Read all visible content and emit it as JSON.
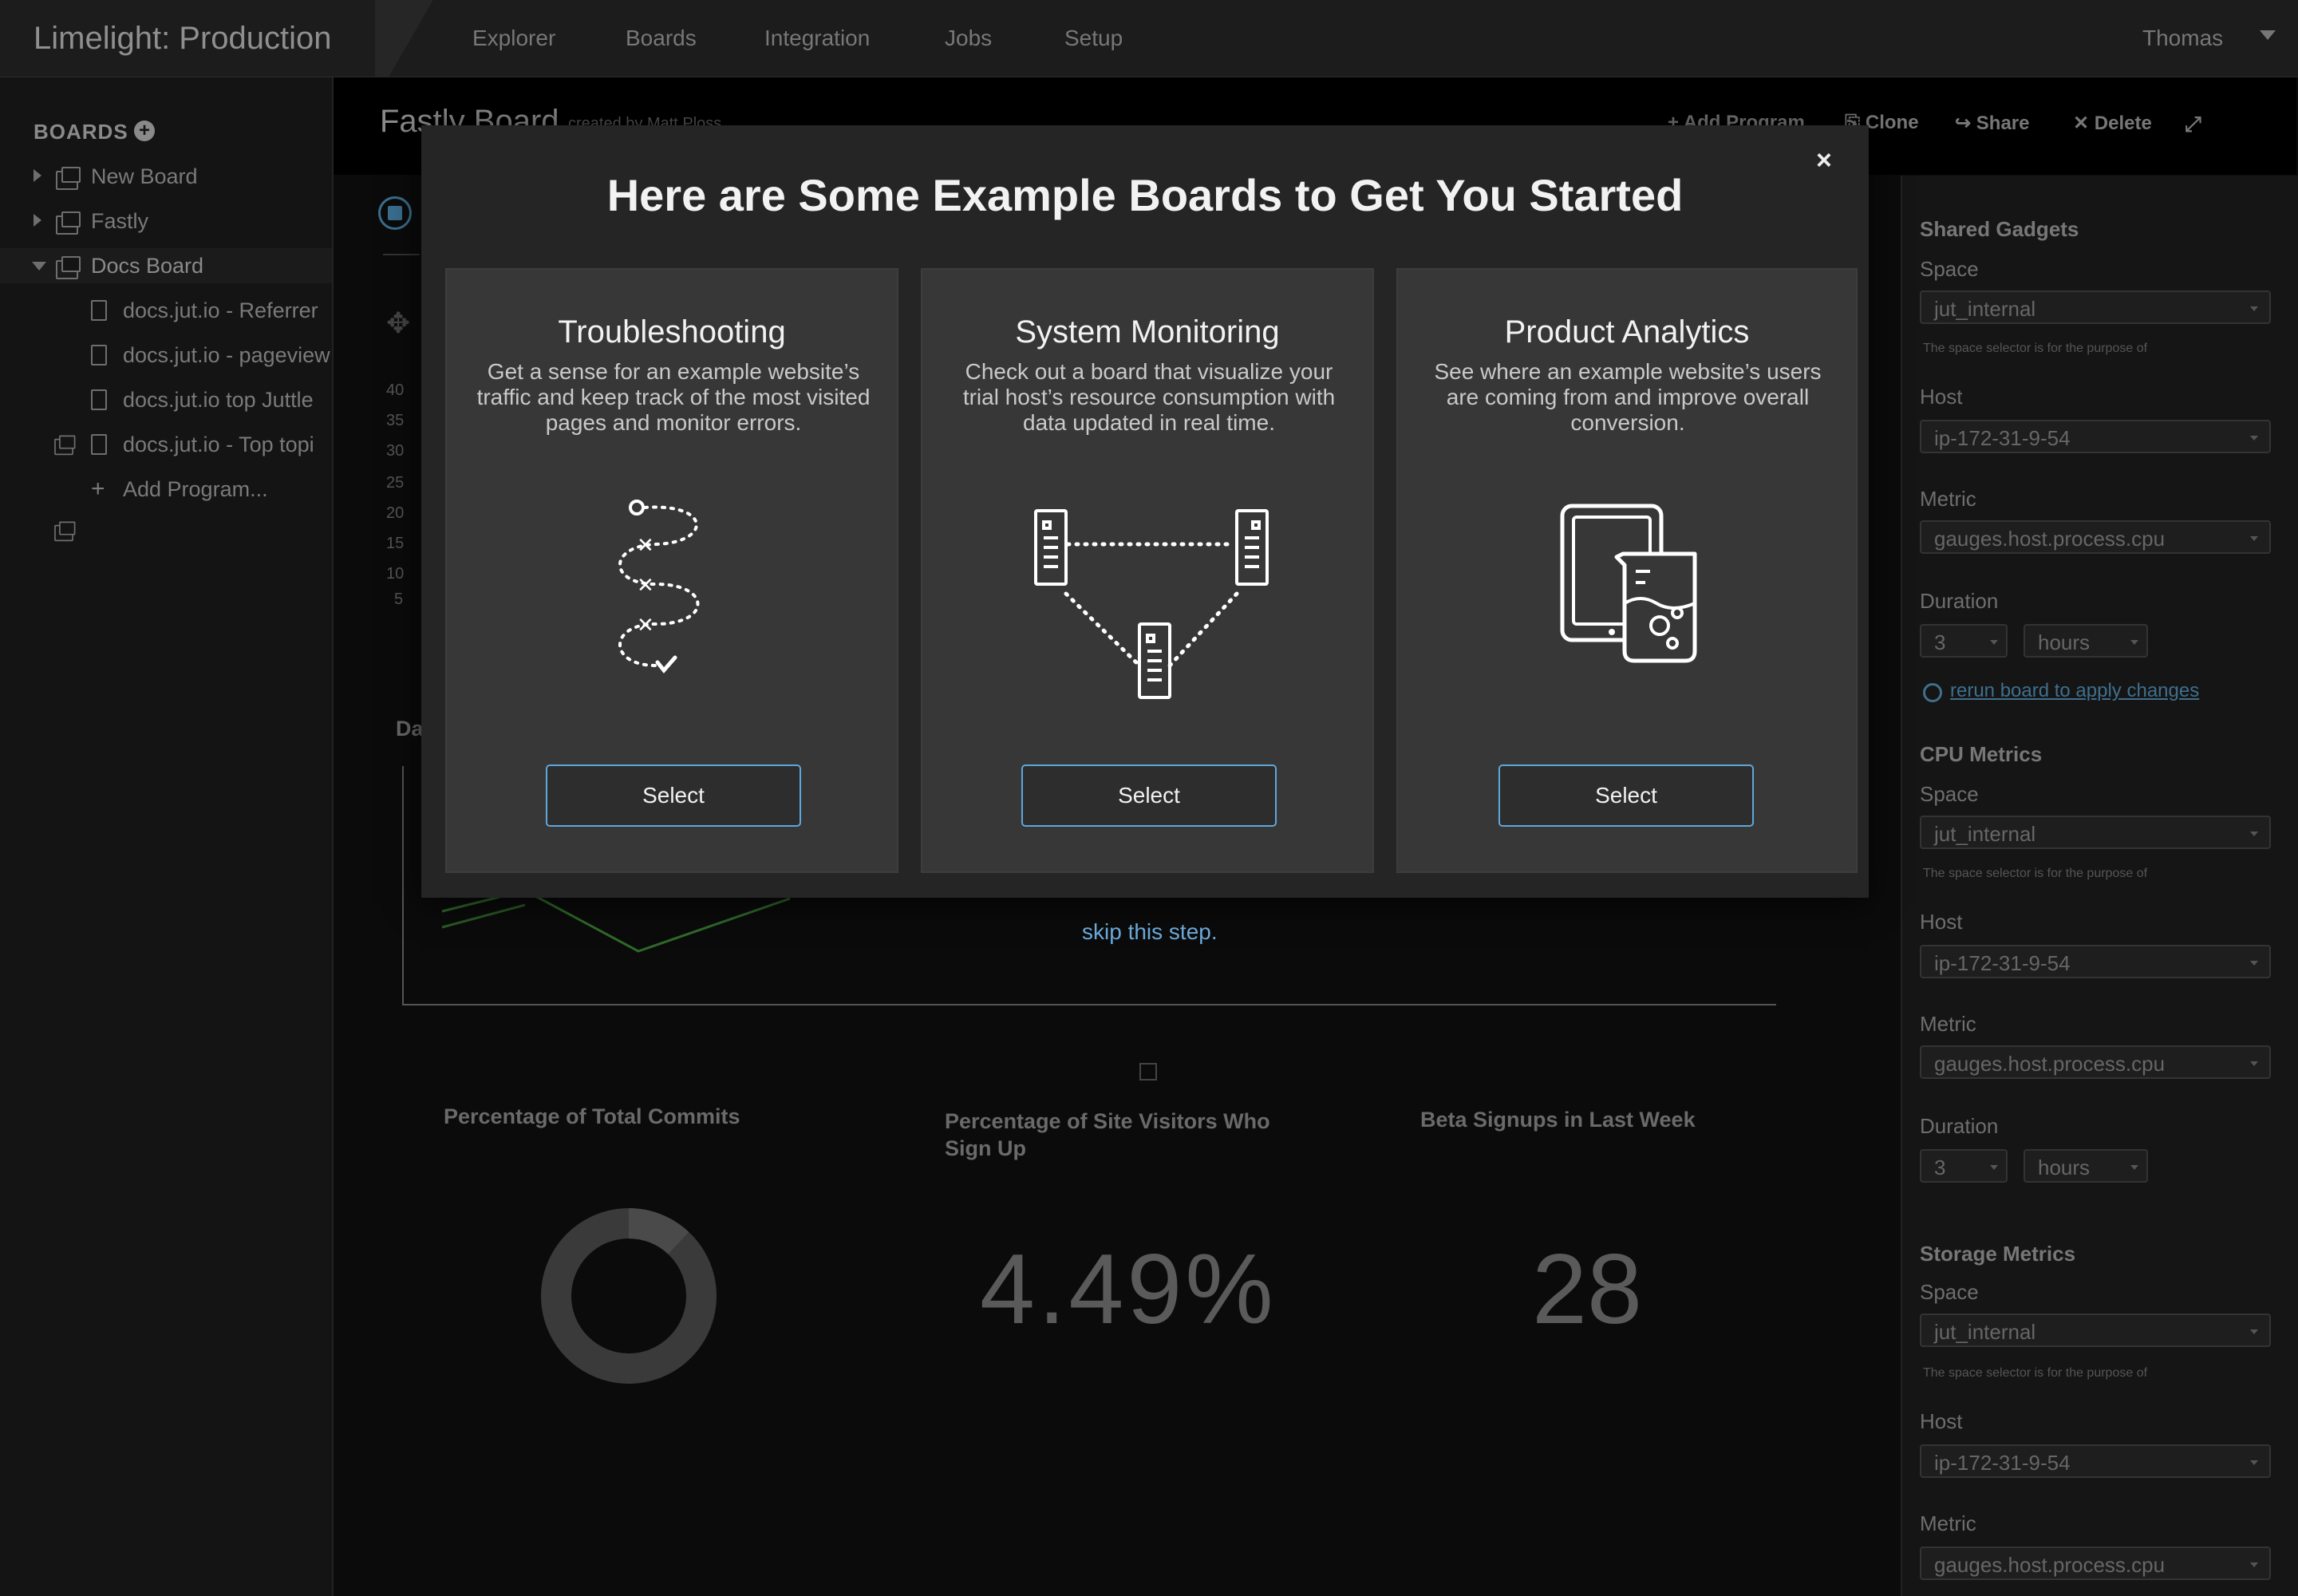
{
  "header": {
    "app_title": "Limelight: Production",
    "nav": [
      "Explorer",
      "Boards",
      "Integration",
      "Jobs",
      "Setup"
    ],
    "user": "Thomas"
  },
  "sidebar": {
    "heading": "BOARDS",
    "items": [
      {
        "label": "New Board"
      },
      {
        "label": "Fastly"
      },
      {
        "label": "Docs Board"
      }
    ],
    "programs": [
      {
        "label": "docs.jut.io - Referrer"
      },
      {
        "label": "docs.jut.io - pageview"
      },
      {
        "label": "docs.jut.io top Juttle"
      },
      {
        "label": "docs.jut.io - Top topi"
      }
    ],
    "add_program": "Add Program..."
  },
  "board": {
    "title": "Fastly Board",
    "subtitle": "created by Matt Ploss",
    "actions": {
      "add_program": "Add Program",
      "clone": "Clone",
      "share": "Share",
      "delete": "Delete"
    },
    "y_ticks": [
      "40",
      "35",
      "30",
      "25",
      "20",
      "15",
      "10",
      "5"
    ],
    "section_label": "Da",
    "gadgets": {
      "commits_title": "Percentage of Total Commits",
      "commits_share": 0.12,
      "visitors_title": "Percentage of Site Visitors Who Sign Up",
      "visitors_value": "4.49%",
      "signups_title": "Beta Signups in Last Week",
      "signups_value": "28"
    }
  },
  "right_panel": {
    "sections": [
      {
        "title": "Shared Gadgets",
        "space_label": "Space",
        "space": "jut_internal",
        "help": "The space selector is for the purpose of",
        "host_label": "Host",
        "host": "ip-172-31-9-54",
        "metric_label": "Metric",
        "metric": "gauges.host.process.cpu",
        "duration_label": "Duration",
        "duration_value": "3",
        "duration_unit": "hours",
        "rerun": "rerun board to apply changes"
      },
      {
        "title": "CPU Metrics",
        "space_label": "Space",
        "space": "jut_internal",
        "help": "The space selector is for the purpose of",
        "host_label": "Host",
        "host": "ip-172-31-9-54",
        "metric_label": "Metric",
        "metric": "gauges.host.process.cpu",
        "duration_label": "Duration",
        "duration_value": "3",
        "duration_unit": "hours"
      },
      {
        "title": "Storage Metrics",
        "space_label": "Space",
        "space": "jut_internal",
        "help": "The space selector is for the purpose of",
        "host_label": "Host",
        "host": "ip-172-31-9-54",
        "metric_label": "Metric",
        "metric": "gauges.host.process.cpu"
      }
    ]
  },
  "modal": {
    "title": "Here are Some Example Boards to Get You Started",
    "close": "×",
    "cards": [
      {
        "title": "Troubleshooting",
        "description": "Get a sense for an example website’s traffic and keep track of the most visited pages and monitor errors.",
        "button": "Select",
        "icon": "winding-path-icon"
      },
      {
        "title": "System Monitoring",
        "description": "Check out a board that visualize your trial host’s resource consumption with data updated in real time.",
        "button": "Select",
        "icon": "server-network-icon"
      },
      {
        "title": "Product Analytics",
        "description": "See where an example website’s users are coming from and  improve overall conversion.",
        "button": "Select",
        "icon": "tablet-beaker-icon"
      }
    ],
    "skip": "skip this step."
  }
}
